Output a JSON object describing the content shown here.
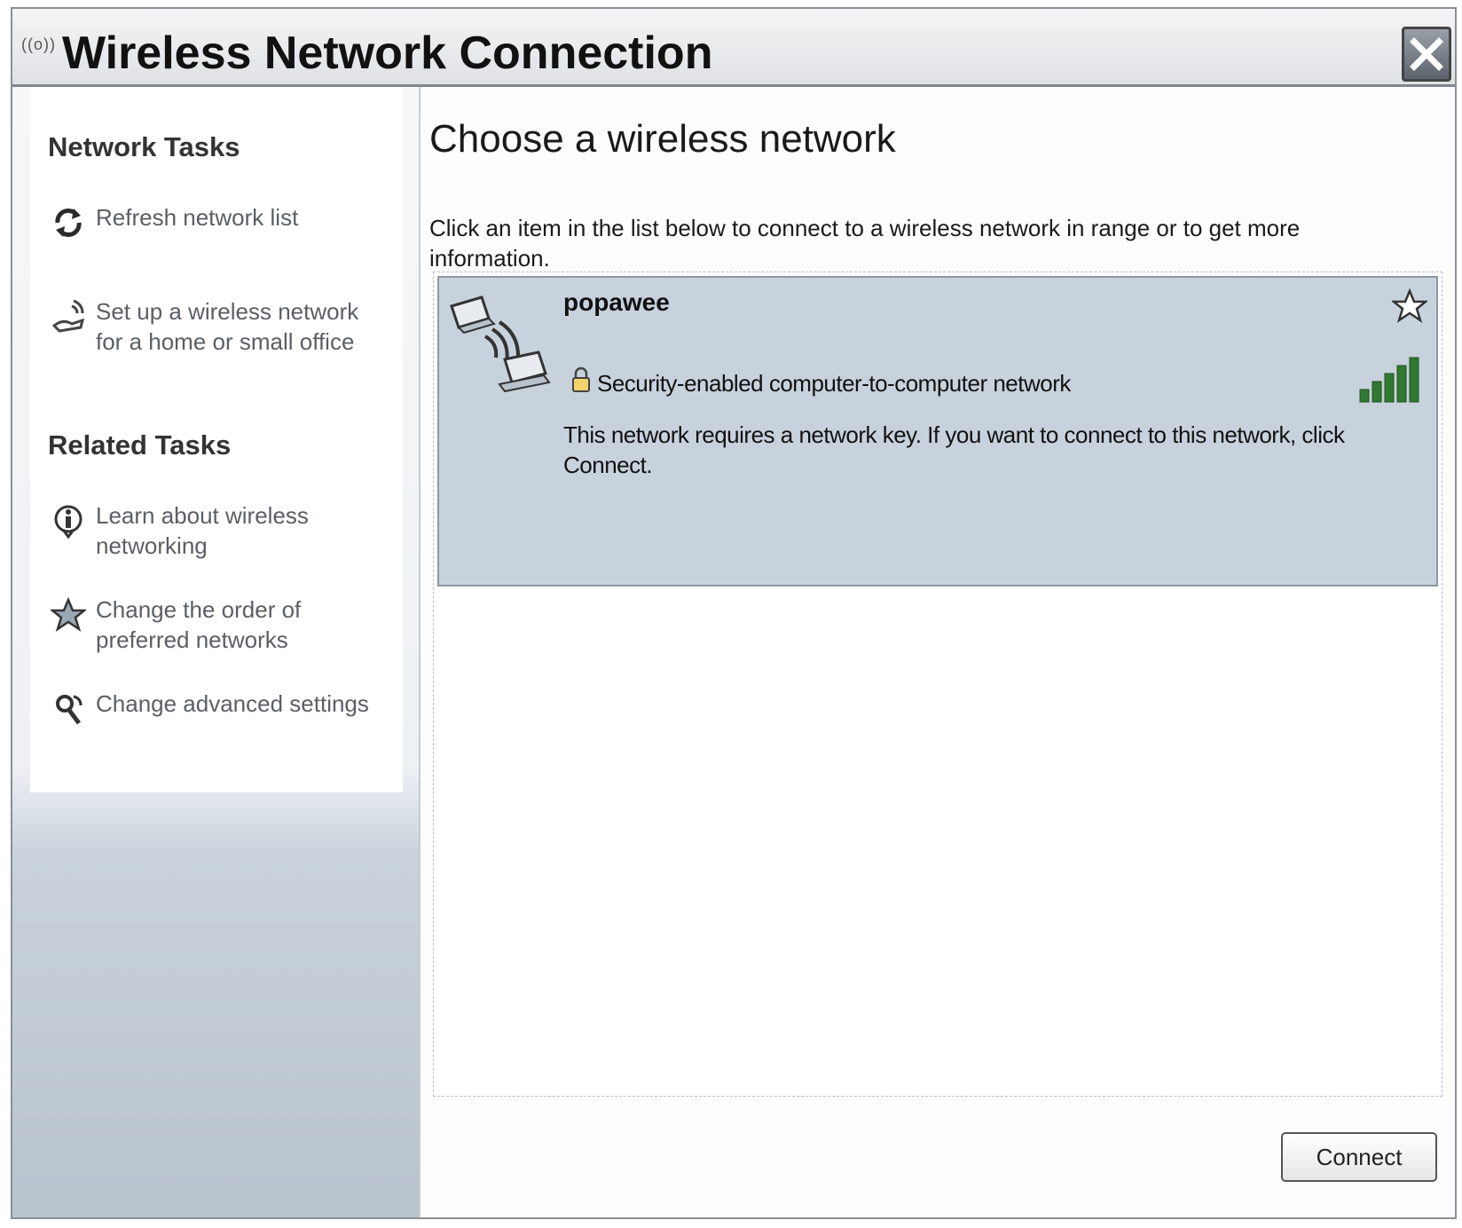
{
  "window": {
    "title": "Wireless Network Connection",
    "title_icon": "((o))"
  },
  "sidebar": {
    "network_tasks_title": "Network Tasks",
    "network_tasks": [
      {
        "label": "Refresh network list",
        "icon": "refresh-icon"
      },
      {
        "label": "Set up a wireless network for a home or small office",
        "icon": "wireless-setup-icon"
      }
    ],
    "related_tasks_title": "Related Tasks",
    "related_tasks": [
      {
        "label": "Learn about wireless networking",
        "icon": "info-icon"
      },
      {
        "label": "Change the order of preferred networks",
        "icon": "star-icon"
      },
      {
        "label": "Change advanced settings",
        "icon": "settings-icon"
      }
    ]
  },
  "main": {
    "heading": "Choose a wireless network",
    "instructions": "Click an item in the list below to connect to a wireless network in range or to get more information.",
    "networks": [
      {
        "name": "popawee",
        "security": "Security-enabled computer-to-computer network",
        "description": "This network requires a network key. If you want to connect to this network, click Connect.",
        "signal_bars": 5,
        "icon": "computer-to-computer-icon"
      }
    ],
    "connect_label": "Connect"
  },
  "colors": {
    "selected_item_bg": "#c8d2dd",
    "accent": "#2f7a2f"
  }
}
